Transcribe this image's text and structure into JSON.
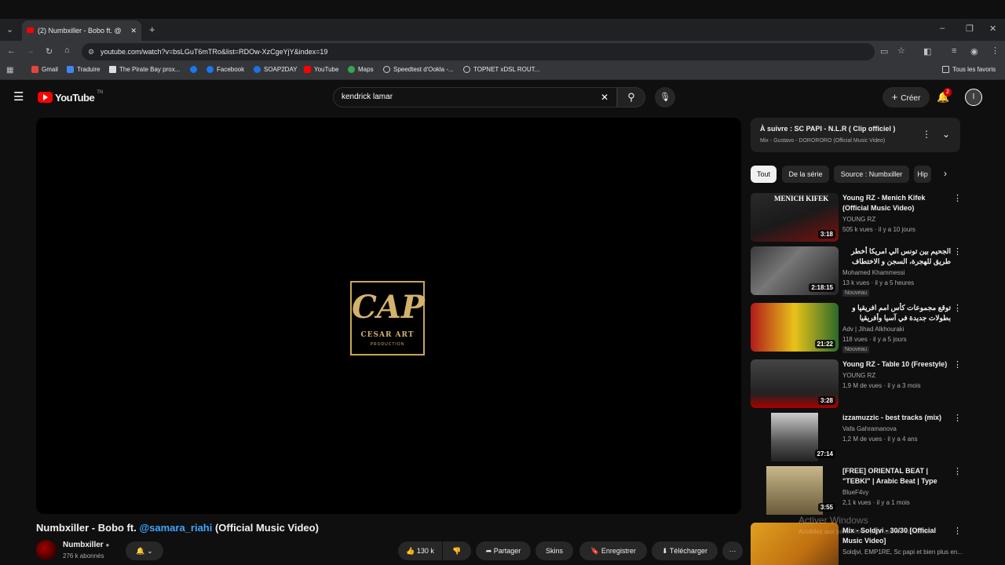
{
  "browser": {
    "tab_title": "(2) Numbxiller - Bobo ft. @",
    "url": "youtube.com/watch?v=bsLGuT6mTRo&list=RDOw-XzCgeYjY&index=19",
    "bookmarks": [
      "Gmail",
      "Traduire",
      "The Pirate Bay prox...",
      "Facebook",
      "SOAP2DAY",
      "YouTube",
      "Maps",
      "Speedtest d'Ookla -...",
      "TOPNET xDSL ROUT..."
    ],
    "all_bookmarks": "Tous les favoris"
  },
  "header": {
    "logo_text": "YouTube",
    "logo_suffix": "TN",
    "search_value": "kendrick lamar",
    "create_label": "Créer",
    "notif_count": "2",
    "avatar_letter": "I"
  },
  "player": {
    "logo_big": "CAP",
    "logo_sub": "CESAR ART",
    "logo_sub2": "PRODUCTION"
  },
  "video": {
    "title_part1": "Numbxiller - Bobo ft. ",
    "title_mention": "@samara_riahi",
    "title_part2": " (Official Music Video)",
    "channel": "Numbxiller",
    "subscribers": "276 k abonnés",
    "likes": "130 k",
    "share": "Partager",
    "skins": "Skins",
    "save": "Enregistrer",
    "download": "Télécharger"
  },
  "sidebar": {
    "up_next_title": "À suivre : SC PAPI - N.L.R ( Clip officiel )",
    "up_next_sub": "Mix - Gustavo - DORORORO (Official Music Video)",
    "chips": [
      "Tout",
      "De la série",
      "Source : Numbxiller",
      "Hip"
    ],
    "items": [
      {
        "title": "Young RZ - Menich Kifek (Official Music Video)",
        "channel": "YOUNG RZ",
        "meta": "505 k vues · il y a 10 jours",
        "duration": "3:18",
        "badge": ""
      },
      {
        "title": "الجحيم بين تونس الي امريكا أخطر طريق للهجرة، السجن و الاختطاف في المكسيك من",
        "channel": "Mohamed Khammessi",
        "meta": "13 k vues · il y a 5 heures",
        "duration": "2:18:15",
        "badge": "Nouveau"
      },
      {
        "title": "توقع مجموعات كأس امم افريقيا و بطولات جديدة في آسيا وأفريقيا",
        "channel": "Adv | Jihad Alkhouraki",
        "meta": "118 vues · il y a 5 jours",
        "duration": "21:22",
        "badge": "Nouveau"
      },
      {
        "title": "Young RZ - Table 10 (Freestyle)",
        "channel": "YOUNG RZ",
        "meta": "1,9 M de vues · il y a 3 mois",
        "duration": "3:28",
        "badge": ""
      },
      {
        "title": "izzamuzzic - best tracks (mix)",
        "channel": "Vafa Gahramanova",
        "meta": "1,2 M de vues · il y a 4 ans",
        "duration": "27:14",
        "badge": ""
      },
      {
        "title": "[FREE] ORIENTAL BEAT | \"TEBKI\" | Arabic Beat | Type Beat | ...",
        "channel": "BlueF4vy",
        "meta": "2,1 k vues · il y a 1 mois",
        "duration": "3:55",
        "badge": ""
      },
      {
        "title": "Mix - Soldjvi - 30/30 [Official Music Video]",
        "channel": "Soldjvi, EMP1RE, Sc papi et bien plus en...",
        "meta": "",
        "duration": "",
        "badge": ""
      }
    ]
  },
  "overlay": {
    "watermark": "Activer Windows",
    "watermark_sub": "Accédez aux paramètres pour activer Windows."
  },
  "colors": {
    "accent": "#3ea6ff",
    "youtube_red": "#ff0000",
    "logo_gold": "#d4b26c"
  }
}
